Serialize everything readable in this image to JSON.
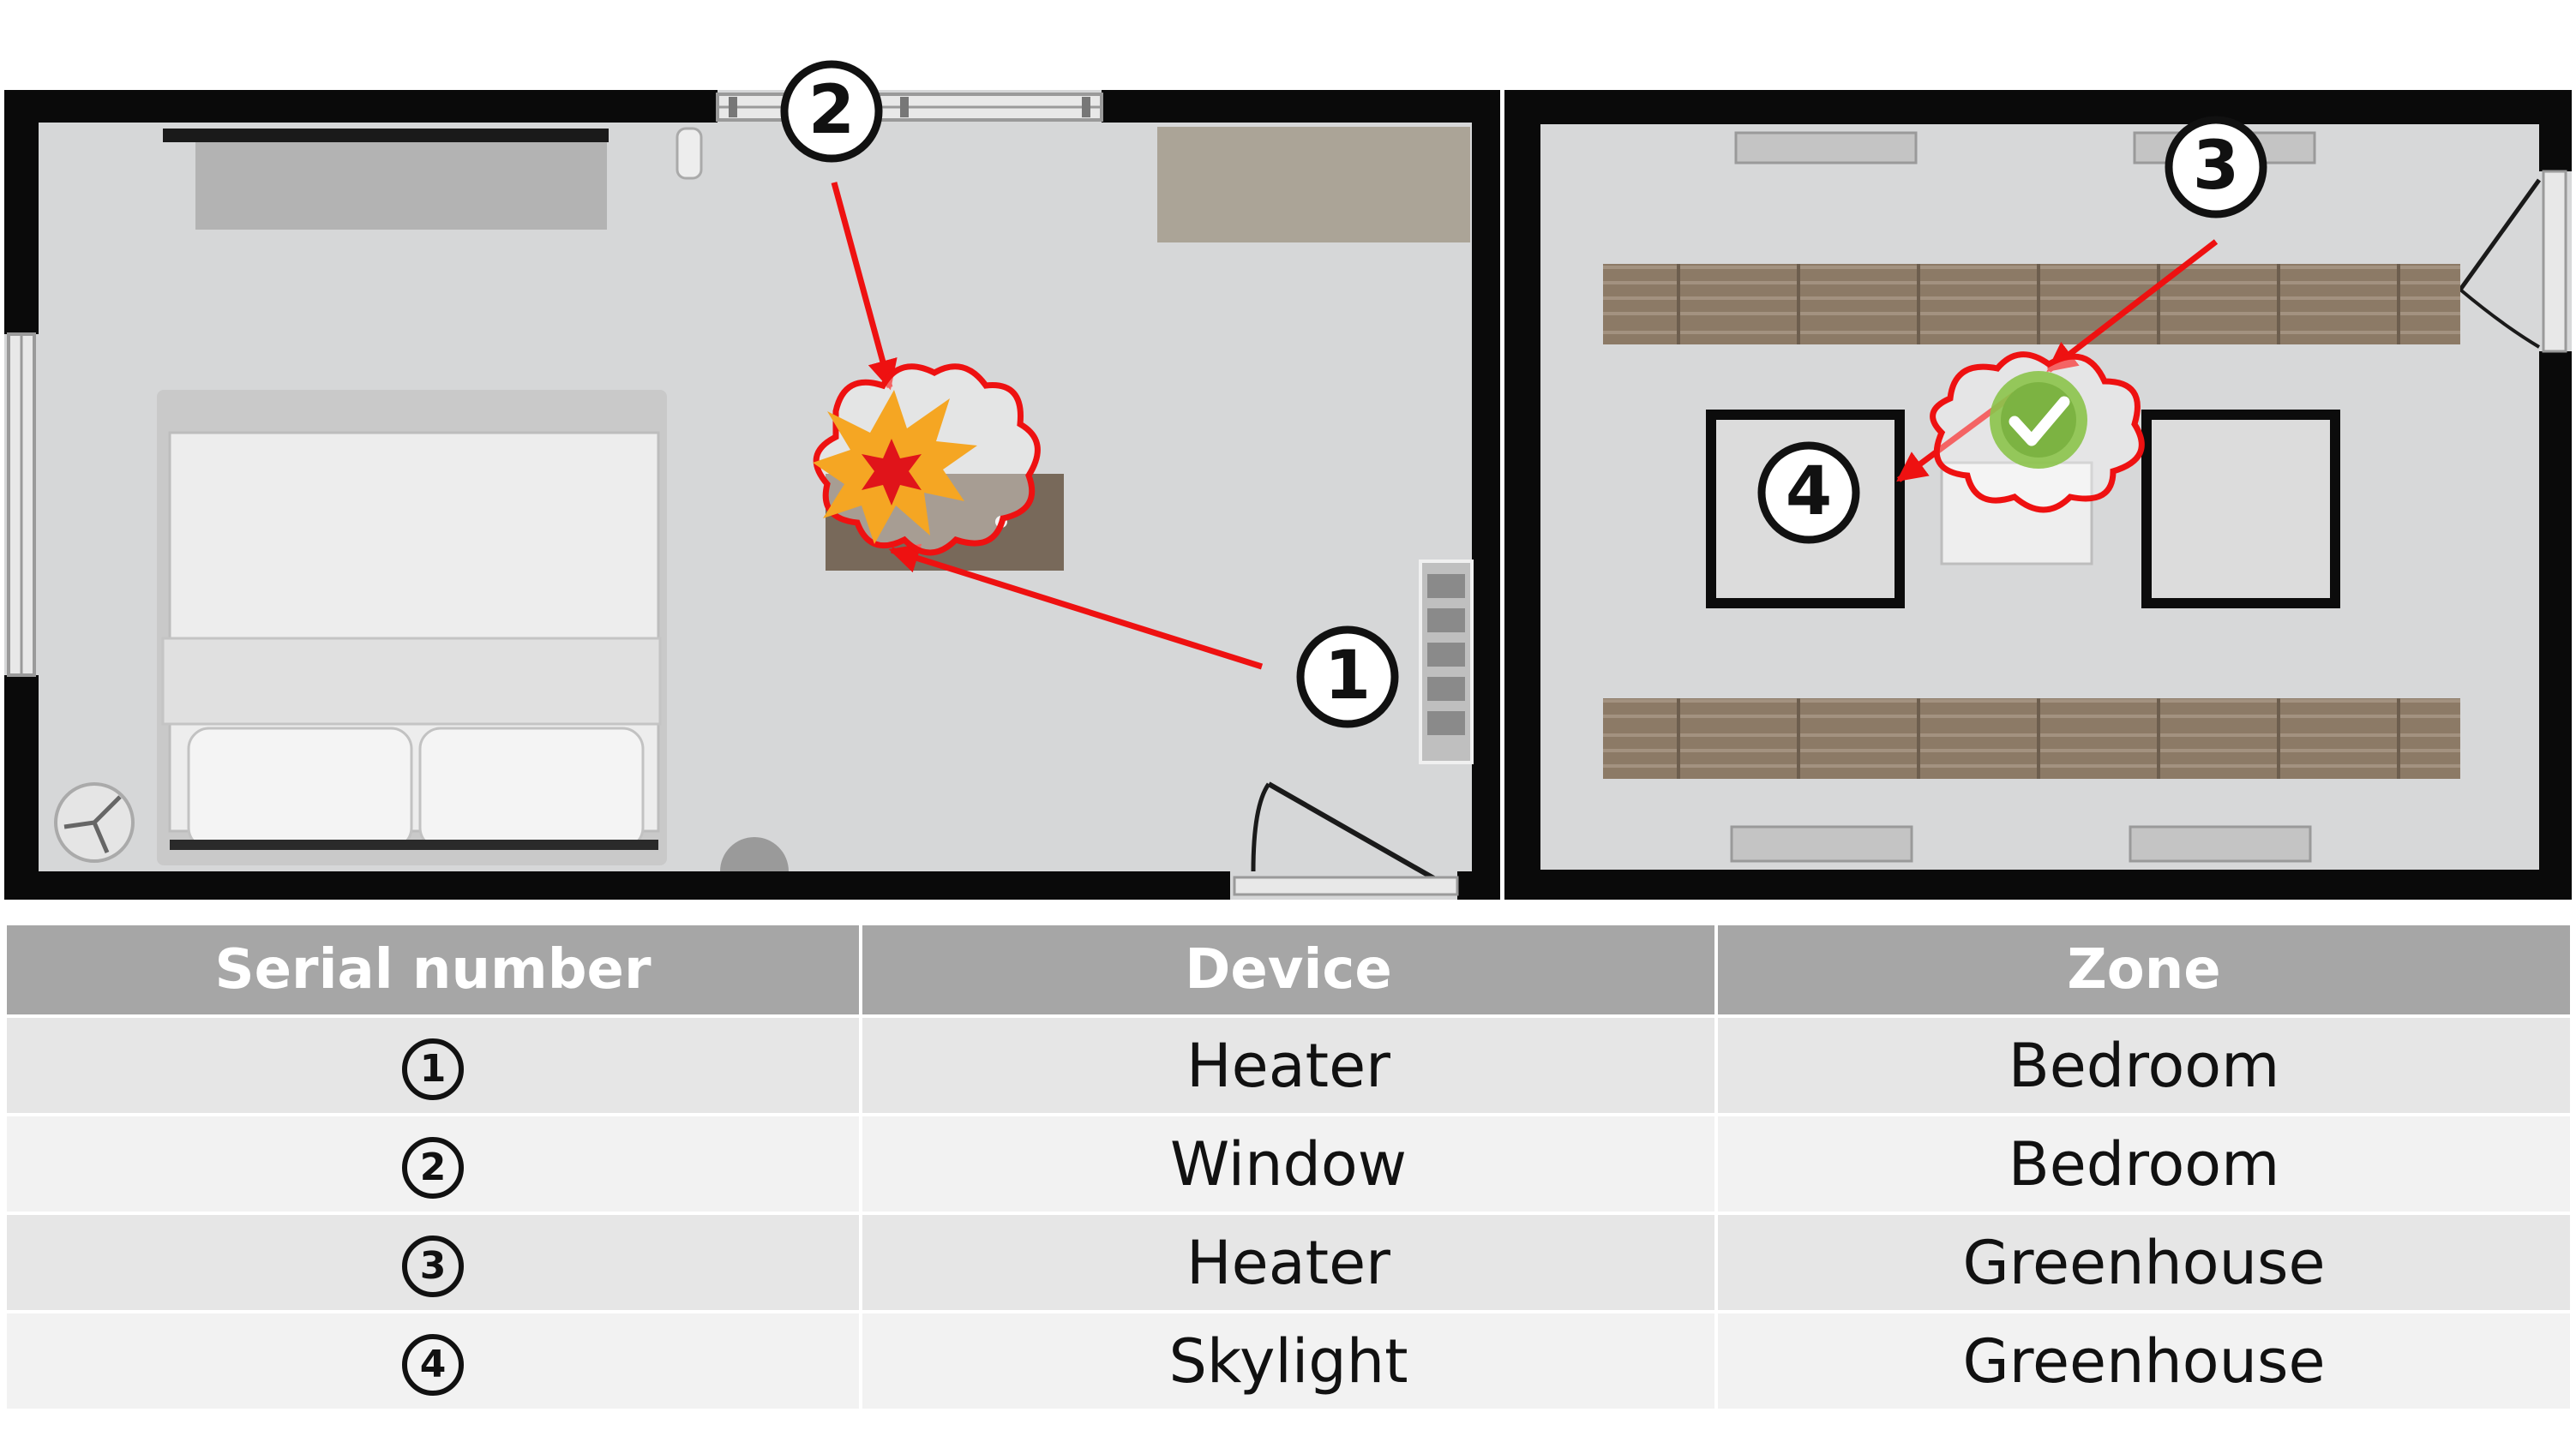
{
  "colors": {
    "wall": "#0a0a0a",
    "floor": "#d6d7d8",
    "arrow": "#ee1111",
    "alert_fill": "#f5a623",
    "ok_fill": "#8bc34a",
    "header_bg": "#a6a6a6",
    "row_odd": "#e6e6e6",
    "row_even": "#f2f2f2"
  },
  "floorplan": {
    "markers": [
      "①",
      "②",
      "③",
      "④"
    ],
    "icons": [
      "explosion-alert-icon",
      "check-ok-icon"
    ]
  },
  "table": {
    "headers": [
      "Serial number",
      "Device",
      "Zone"
    ],
    "rows": [
      {
        "serial": "①",
        "device": "Heater",
        "zone": "Bedroom"
      },
      {
        "serial": "②",
        "device": "Window",
        "zone": "Bedroom"
      },
      {
        "serial": "③",
        "device": "Heater",
        "zone": "Greenhouse"
      },
      {
        "serial": "④",
        "device": "Skylight",
        "zone": "Greenhouse"
      }
    ]
  }
}
